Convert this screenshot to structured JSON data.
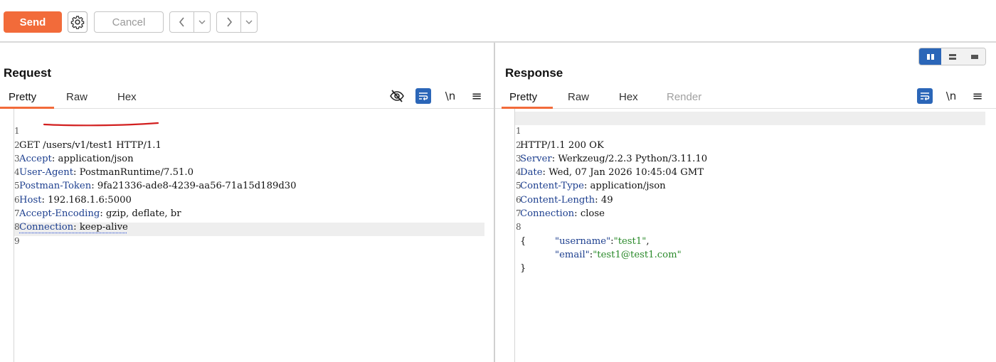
{
  "toolbar": {
    "send_label": "Send",
    "cancel_label": "Cancel",
    "settings_icon": "gear-icon",
    "back_icon": "chevron-left-icon",
    "forward_icon": "chevron-right-icon",
    "dropdown_icon": "chevron-down-icon"
  },
  "request": {
    "title": "Request",
    "tabs": [
      "Pretty",
      "Raw",
      "Hex"
    ],
    "active_tab": "Pretty",
    "newline_label": "\\n",
    "menu_label": "≡",
    "line_numbers": [
      "1",
      "2",
      "3",
      "4",
      "5",
      "6",
      "7",
      "8",
      "9"
    ],
    "lines": [
      {
        "method": "GET",
        "path": "/users/v1/test1",
        "proto": "HTTP/1.1"
      },
      {
        "key": "Accept",
        "value": "application/json"
      },
      {
        "key": "User-Agent",
        "value": "PostmanRuntime/7.51.0"
      },
      {
        "key": "Postman-Token",
        "value": "9fa21336-ade8-4239-aa56-71a15d189d30"
      },
      {
        "key": "Host",
        "value": "192.168.1.6:5000"
      },
      {
        "key": "Accept-Encoding",
        "value": "gzip, deflate, br"
      },
      {
        "key": "Connection",
        "value": "keep-alive"
      }
    ]
  },
  "response": {
    "title": "Response",
    "tabs": [
      "Pretty",
      "Raw",
      "Hex",
      "Render"
    ],
    "active_tab": "Pretty",
    "newline_label": "\\n",
    "menu_label": "≡",
    "line_numbers": [
      "1",
      "2",
      "3",
      "4",
      "5",
      "6",
      "7",
      "8"
    ],
    "status_line": "HTTP/1.1 200 OK",
    "headers": [
      {
        "key": "Server",
        "value": "Werkzeug/2.2.3 Python/3.11.10"
      },
      {
        "key": "Date",
        "value": "Wed, 07 Jan 2026 10:45:04 GMT"
      },
      {
        "key": "Content-Type",
        "value": "application/json"
      },
      {
        "key": "Content-Length",
        "value": "49"
      },
      {
        "key": "Connection",
        "value": "close"
      }
    ],
    "body_open": "{",
    "body_close": "}",
    "body": [
      {
        "key": "\"username\"",
        "sep": ":",
        "value": "\"test1\"",
        "trail": ","
      },
      {
        "key": "\"email\"",
        "sep": ":",
        "value": "\"test1@test1.com\"",
        "trail": ""
      }
    ]
  },
  "colors": {
    "accent": "#f26b3a",
    "blue": "#2b66b8",
    "header_key": "#1d3f8f",
    "json_string": "#2b8a2b",
    "annotation_red": "#d21f1f"
  }
}
